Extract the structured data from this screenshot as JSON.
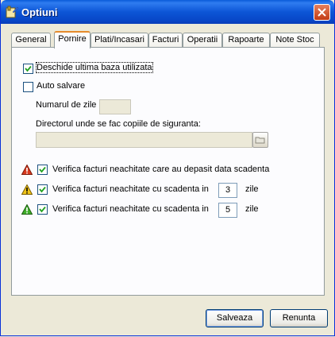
{
  "window": {
    "title": "Optiuni"
  },
  "tabs": [
    "General",
    "Pornire",
    "Plati/Incasari",
    "Facturi",
    "Operatii",
    "Rapoarte",
    "Note Stoc"
  ],
  "active_tab": "Pornire",
  "pornire": {
    "open_last_db": {
      "label": "Deschide ultima baza utilizata",
      "checked": true
    },
    "auto_save": {
      "label": "Auto salvare",
      "checked": false
    },
    "days_label": "Numarul de zile",
    "days_value": "",
    "backup_dir_label": "Directorul unde se fac copiile de siguranta:",
    "backup_dir_value": "",
    "checks": [
      {
        "label": "Verifica facturi neachitate care au depasit data scadenta",
        "checked": true,
        "icon_color": "#d93a1f"
      },
      {
        "label": "Verifica facturi neachitate cu scadenta in",
        "checked": true,
        "value": "3",
        "unit": "zile",
        "icon_color": "#f0c419"
      },
      {
        "label": "Verifica facturi neachitate cu scadenta in",
        "checked": true,
        "value": "5",
        "unit": "zile",
        "icon_color": "#3fae2a"
      }
    ]
  },
  "buttons": {
    "save": "Salveaza",
    "cancel": "Renunta"
  }
}
